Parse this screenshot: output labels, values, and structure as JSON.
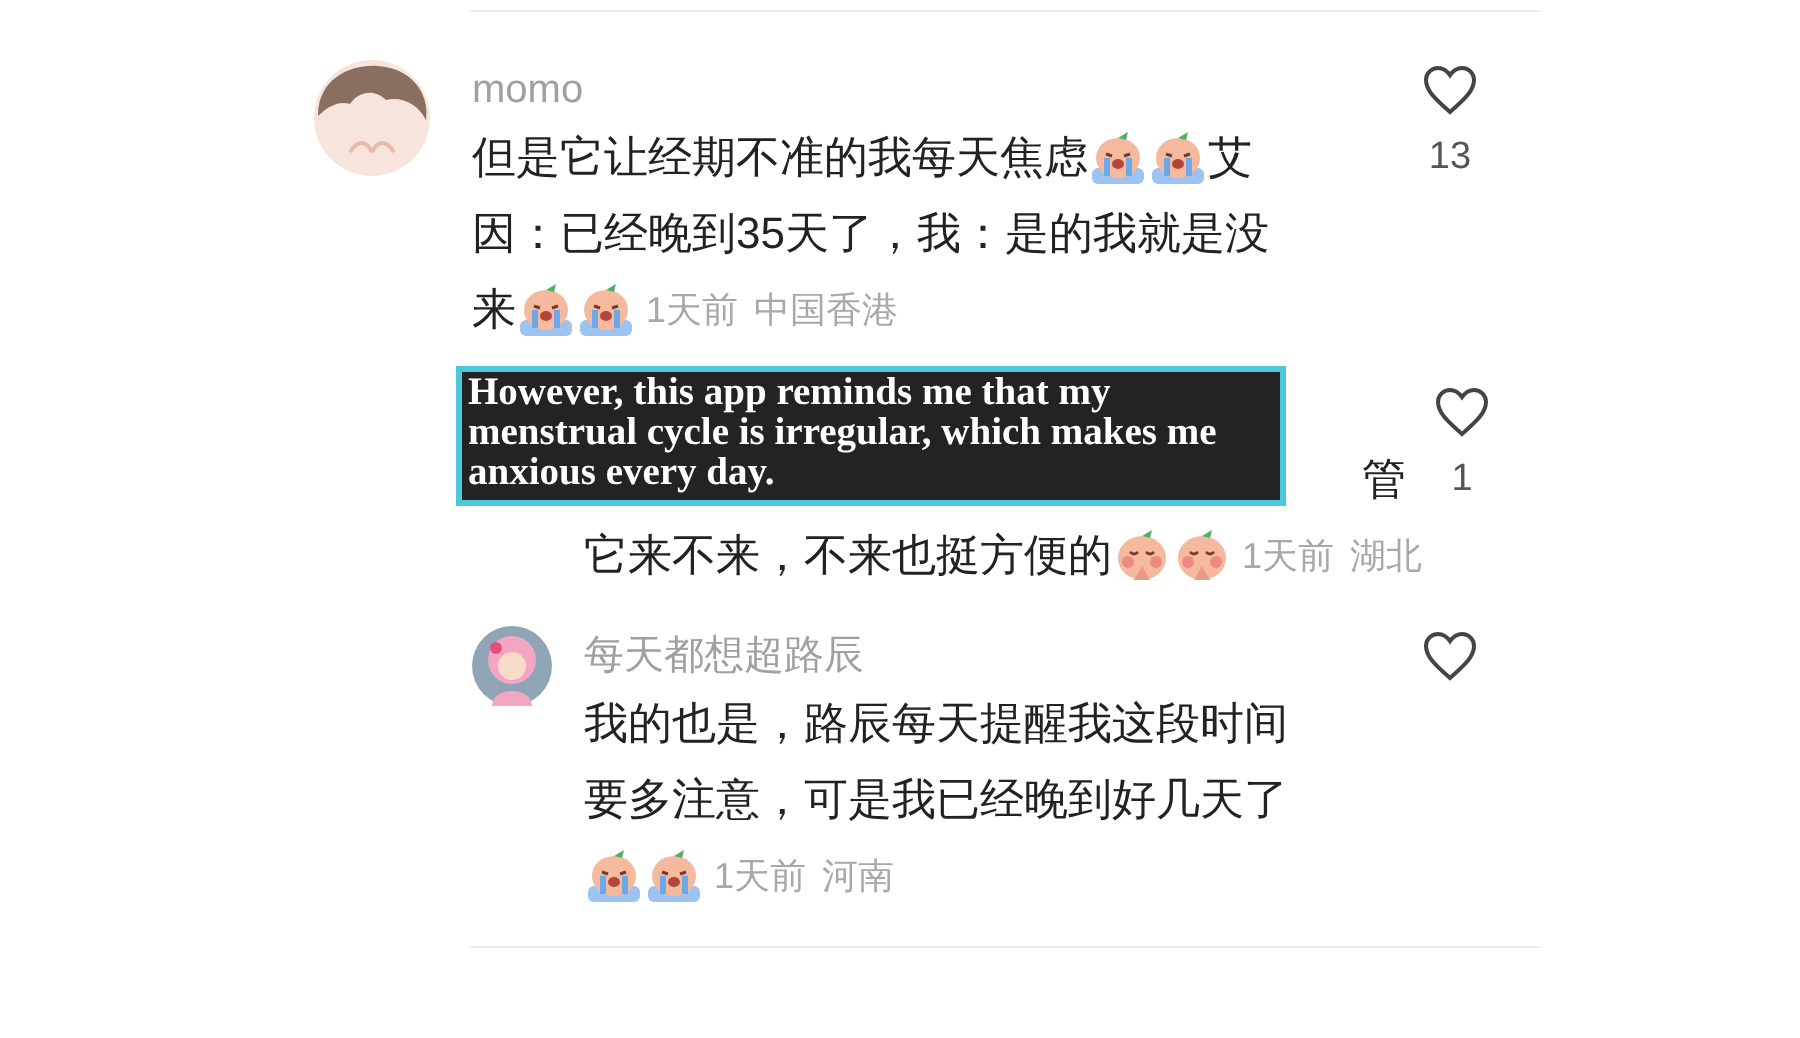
{
  "comments": [
    {
      "avatar": {
        "kind": "hair"
      },
      "reply": false,
      "username": "momo",
      "liked": false,
      "likes": "13",
      "lines": [
        [
          {
            "kind": "text",
            "text": "但是它让经期不准的我每天焦虑"
          },
          {
            "kind": "crying_emoji"
          },
          {
            "kind": "crying_emoji"
          },
          {
            "kind": "text",
            "text": "艾"
          }
        ],
        [
          {
            "kind": "text",
            "text": "因：已经晚到35天了，我：是的我就是没"
          }
        ],
        [
          {
            "kind": "text",
            "text": "来"
          },
          {
            "kind": "crying_emoji"
          },
          {
            "kind": "crying_emoji"
          }
        ]
      ],
      "time": "1天前",
      "location": "中国香港"
    },
    {
      "reply": true,
      "liked": false,
      "likes": "1",
      "first_line_tail": "管",
      "lines": [
        [
          {
            "kind": "text",
            "text": "它来不来，不来也挺方便的"
          },
          {
            "kind": "shy_emoji"
          },
          {
            "kind": "shy_emoji"
          }
        ]
      ],
      "time": "1天前",
      "location": "湖北"
    },
    {
      "avatar": {
        "kind": "pink"
      },
      "reply": true,
      "username": "每天都想超路辰",
      "liked": false,
      "lines": [
        [
          {
            "kind": "text",
            "text": "我的也是，路辰每天提醒我这段时间"
          }
        ],
        [
          {
            "kind": "text",
            "text": "要多注意，可是我已经晚到好几天了"
          }
        ],
        [
          {
            "kind": "crying_emoji"
          },
          {
            "kind": "crying_emoji"
          }
        ]
      ],
      "time": "1天前",
      "location": "河南"
    }
  ],
  "caption": {
    "text": "However, this app reminds me that my menstrual cycle is irregular, which makes me anxious every day."
  }
}
